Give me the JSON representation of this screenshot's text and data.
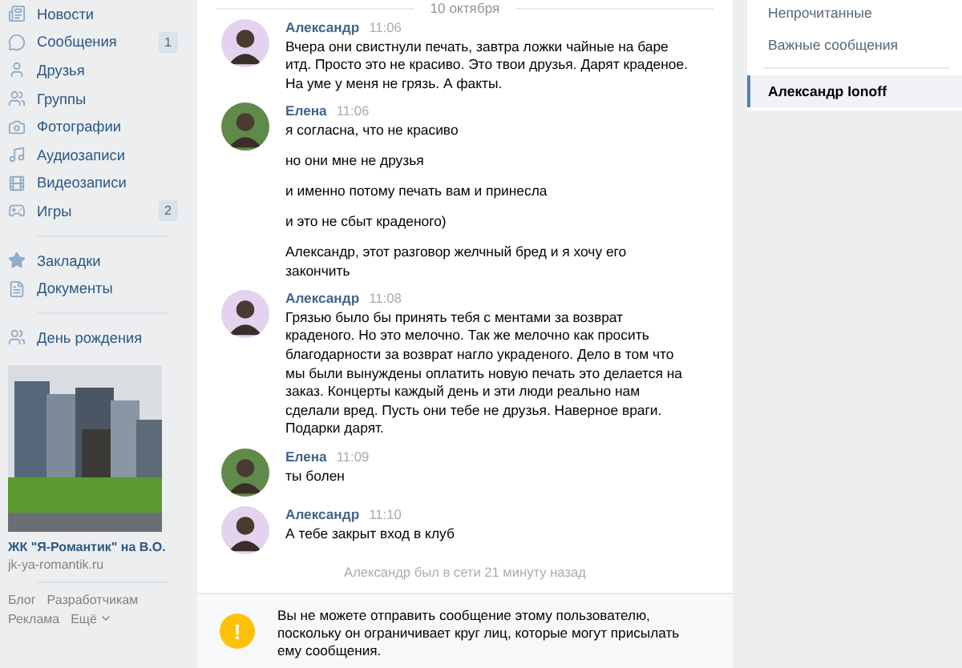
{
  "sidebar": {
    "nav": [
      {
        "label": "Новости"
      },
      {
        "label": "Сообщения",
        "badge": "1"
      },
      {
        "label": "Друзья"
      },
      {
        "label": "Группы"
      },
      {
        "label": "Фотографии"
      },
      {
        "label": "Аудиозаписи"
      },
      {
        "label": "Видеозаписи"
      },
      {
        "label": "Игры",
        "badge": "2"
      }
    ],
    "nav_secondary": [
      {
        "label": "Закладки"
      },
      {
        "label": "Документы"
      }
    ],
    "birthday": {
      "label": "День рождения"
    },
    "ad": {
      "kind": "picture",
      "title": "ЖК \"Я-Романтик\" на В.О.",
      "url": "jk-ya-romantik.ru"
    },
    "footer_links": [
      "Блог",
      "Разработчикам",
      "Реклама",
      "Ещё"
    ]
  },
  "chat": {
    "date": "10 октября",
    "messages": [
      {
        "author": "Александр",
        "time": "11:06",
        "color": "#e4d3ef",
        "texts": [
          "Вчера они свистнули печать, завтра ложки чайные на баре итд. Просто это не красиво. Это твои друзья. Дарят краденое. На уме у меня не грязь. А факты."
        ]
      },
      {
        "author": "Елена",
        "time": "11:06",
        "color": "#5f8a4a",
        "texts": [
          "я согласна, что не красиво",
          "но они мне не друзья",
          "и именно потому печать вам и принесла",
          "и это не сбыт краденого)",
          "Александр, этот разговор желчный бред и я хочу его закончить"
        ]
      },
      {
        "author": "Александр",
        "time": "11:08",
        "color": "#e4d3ef",
        "texts": [
          "Грязью было бы принять тебя с ментами за возврат краденого. Но это мелочно. Так же мелочно как просить благодарности за возврат нагло украденого. Дело в том что мы были вынуждены оплатить новую печать это делается на заказ. Концерты каждый день и эти люди реально нам сделали вред. Пусть они тебе не друзья. Наверное враги. Подарки дарят."
        ]
      },
      {
        "author": "Елена",
        "time": "11:09",
        "color": "#5f8a4a",
        "texts": [
          "ты болен"
        ]
      },
      {
        "author": "Александр",
        "time": "11:10",
        "color": "#e4d3ef",
        "texts": [
          "А тебе закрыт вход в клуб"
        ]
      }
    ],
    "last_seen": "Александр был в сети 21 минуту назад",
    "notice": {
      "icon": "!",
      "text": "Вы не можете отправить сообщение этому пользователю, поскольку он ограничивает круг лиц, которые могут присылать ему сообщения."
    }
  },
  "filters": [
    {
      "label": "Непрочитанные",
      "selected": false
    },
    {
      "label": "Важные сообщения",
      "selected": false
    },
    {
      "label": "Александр Ionoff",
      "selected": true
    }
  ]
}
